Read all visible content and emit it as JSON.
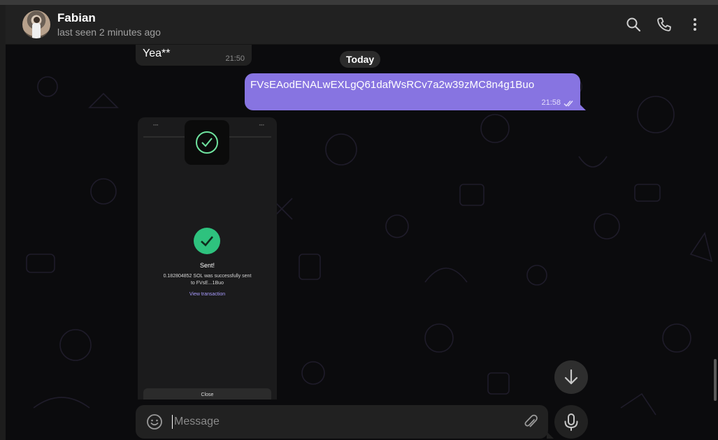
{
  "contact": {
    "name": "Fabian",
    "status": "last seen 2 minutes ago"
  },
  "header_icons": [
    "search-icon",
    "phone-icon",
    "more-vertical-icon"
  ],
  "chat": {
    "previous_message": {
      "text": "Yea**",
      "time": "21:50"
    },
    "day_separator": "Today",
    "outgoing_message": {
      "text": "FVsEAodENALwEXLgQ61dafWsRCv7a2w39zMC8n4g1Buo",
      "time": "21:58",
      "read_status": "double-check-icon"
    },
    "photo_message": {
      "sent_title": "Sent!",
      "sent_line1": "0.182804852 SOL was successfully sent",
      "sent_line2": "to FVsE...1Buo",
      "link": "View transaction",
      "close_button": "Close"
    }
  },
  "composer": {
    "placeholder": "Message",
    "value": ""
  },
  "colors": {
    "outgoing_bubble": "#8774e1",
    "incoming_bubble": "#212121",
    "success_green": "#2ec27e",
    "link_purple": "#a99cff"
  }
}
